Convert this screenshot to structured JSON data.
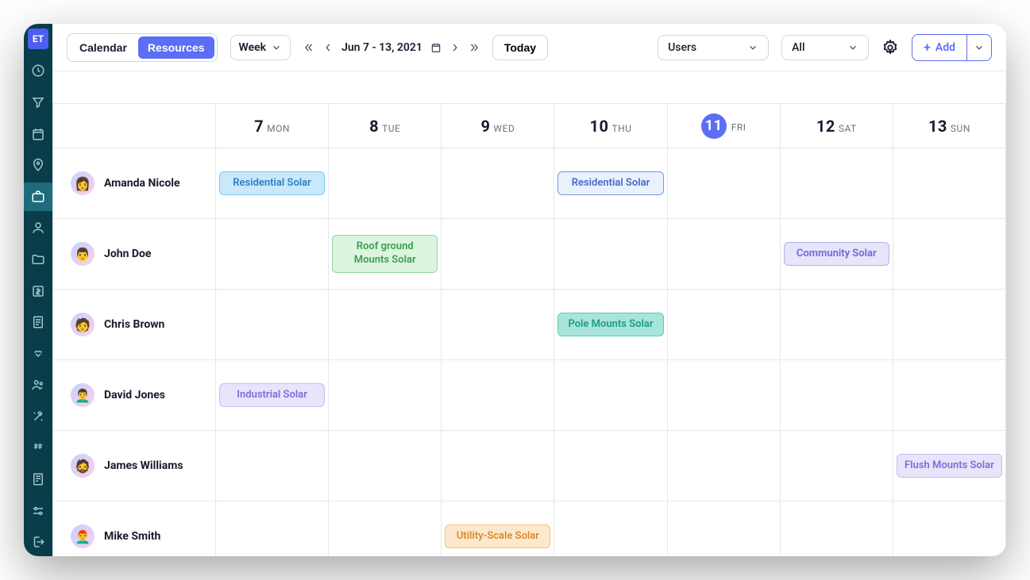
{
  "logo": "ET",
  "toolbar": {
    "tab_calendar": "Calendar",
    "tab_resources": "Resources",
    "view_dropdown": "Week",
    "date_range": "Jun 7 - 13, 2021",
    "today": "Today",
    "filter_users": "Users",
    "filter_all": "All",
    "add_label": "Add"
  },
  "days": [
    {
      "num": "7",
      "name": "MON",
      "today": false
    },
    {
      "num": "8",
      "name": "TUE",
      "today": false
    },
    {
      "num": "9",
      "name": "WED",
      "today": false
    },
    {
      "num": "10",
      "name": "THU",
      "today": false
    },
    {
      "num": "11",
      "name": "FRI",
      "today": true
    },
    {
      "num": "12",
      "name": "SAT",
      "today": false
    },
    {
      "num": "13",
      "name": "SUN",
      "today": false
    }
  ],
  "resources": [
    {
      "name": "Amanda Nicole",
      "emoji": "👩"
    },
    {
      "name": "John Doe",
      "emoji": "👨"
    },
    {
      "name": "Chris Brown",
      "emoji": "🧑"
    },
    {
      "name": "David Jones",
      "emoji": "👨‍🦱"
    },
    {
      "name": "James Williams",
      "emoji": "🧔"
    },
    {
      "name": "Mike Smith",
      "emoji": "👨‍🦰"
    }
  ],
  "events": [
    {
      "resource": 0,
      "day": 0,
      "label": "Residential Solar",
      "theme": "c-blue"
    },
    {
      "resource": 0,
      "day": 3,
      "label": "Residential Solar",
      "theme": "c-blueoutline"
    },
    {
      "resource": 1,
      "day": 1,
      "label": "Roof ground Mounts Solar",
      "theme": "c-green"
    },
    {
      "resource": 1,
      "day": 5,
      "label": "Community Solar",
      "theme": "c-lav"
    },
    {
      "resource": 2,
      "day": 3,
      "label": "Pole Mounts Solar",
      "theme": "c-teal"
    },
    {
      "resource": 3,
      "day": 0,
      "label": "Industrial Solar",
      "theme": "c-lavlight"
    },
    {
      "resource": 4,
      "day": 6,
      "label": "Flush Mounts Solar",
      "theme": "c-lavlight"
    },
    {
      "resource": 5,
      "day": 2,
      "label": "Utility-Scale Solar",
      "theme": "c-orange"
    }
  ]
}
